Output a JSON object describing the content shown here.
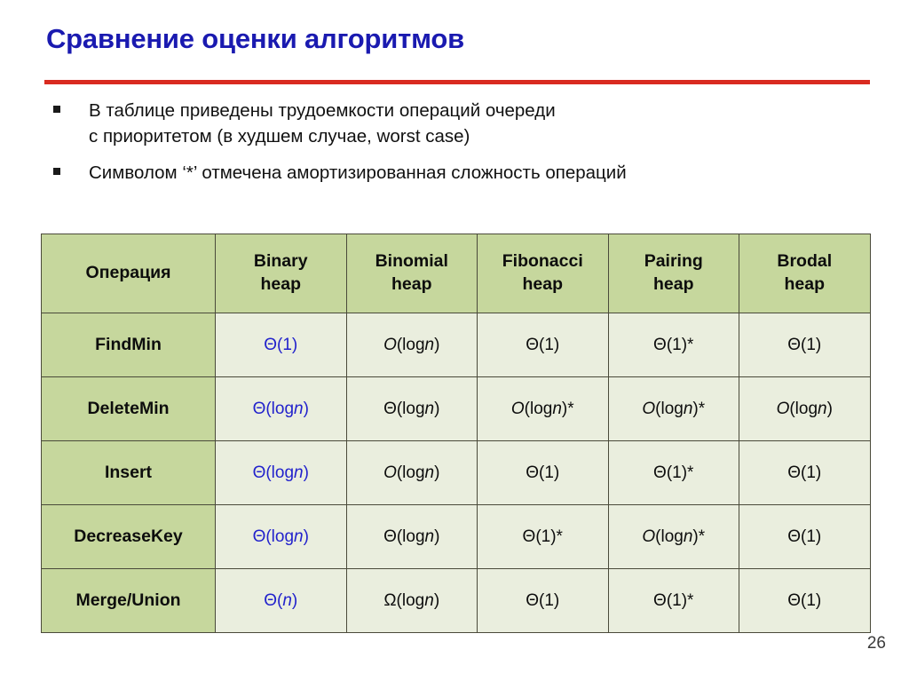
{
  "slide": {
    "title": "Сравнение оценки алгоритмов",
    "page_number": "26",
    "accent_rule_color": "#d92b20",
    "title_color": "#1a1ab0"
  },
  "bullets": [
    {
      "marker": "square-bullet",
      "line1": "В таблице приведены трудоемкости операций очереди",
      "line2": "с приоритетом (в худшем случае, worst case)"
    },
    {
      "marker": "square-bullet",
      "line1": "Символом ‘*’ отмечена амортизированная сложность операций",
      "line2": ""
    }
  ],
  "table": {
    "header_bg": "#c6d79d",
    "cell_bg": "#eaeede",
    "highlight_color": "#2222cc",
    "columns": [
      {
        "line1": "Операция",
        "line2": ""
      },
      {
        "line1": "Binary",
        "line2": "heap"
      },
      {
        "line1": "Binomial",
        "line2": "heap"
      },
      {
        "line1": "Fibonacci",
        "line2": "heap"
      },
      {
        "line1": "Pairing",
        "line2": "heap"
      },
      {
        "line1": "Brodal",
        "line2": "heap"
      }
    ],
    "rows": [
      {
        "operation": "FindMin",
        "binary_heap": "Θ(1)",
        "binomial_heap": "O(logn)",
        "fibonacci_heap": "Θ(1)",
        "pairing_heap": "Θ(1)*",
        "brodal_heap": "Θ(1)"
      },
      {
        "operation": "DeleteMin",
        "binary_heap": "Θ(logn)",
        "binomial_heap": "Θ(logn)",
        "fibonacci_heap": "O(logn)*",
        "pairing_heap": "O(logn)*",
        "brodal_heap": "O(logn)"
      },
      {
        "operation": "Insert",
        "binary_heap": "Θ(logn)",
        "binomial_heap": "O(logn)",
        "fibonacci_heap": "Θ(1)",
        "pairing_heap": "Θ(1)*",
        "brodal_heap": "Θ(1)"
      },
      {
        "operation": "DecreaseKey",
        "binary_heap": "Θ(logn)",
        "binomial_heap": "Θ(logn)",
        "fibonacci_heap": "Θ(1)*",
        "pairing_heap": "O(logn)*",
        "brodal_heap": "Θ(1)"
      },
      {
        "operation": "Merge/Union",
        "binary_heap": "Θ(n)",
        "binomial_heap": "Ω(logn)",
        "fibonacci_heap": "Θ(1)",
        "pairing_heap": "Θ(1)*",
        "brodal_heap": "Θ(1)"
      }
    ]
  }
}
